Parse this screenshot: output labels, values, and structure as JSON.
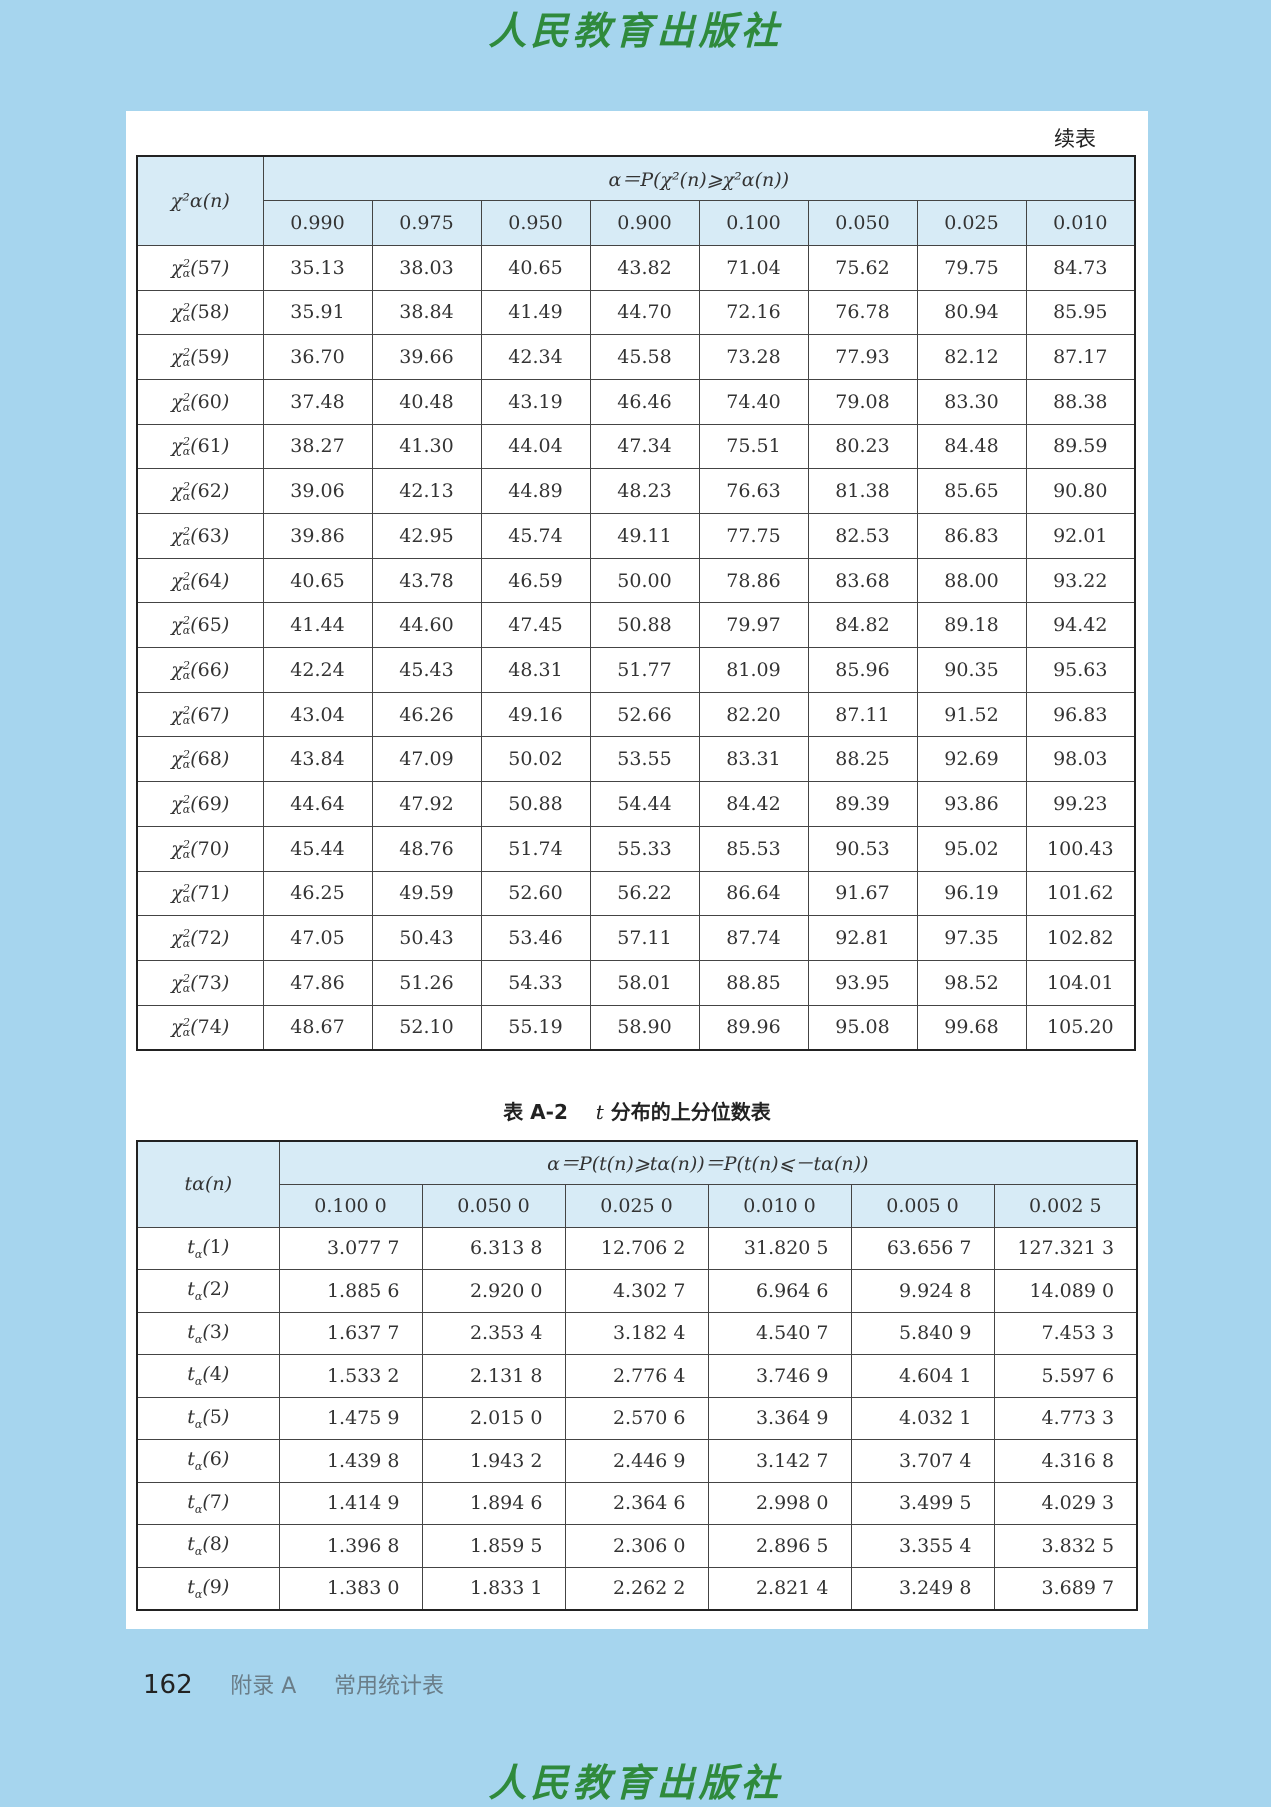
{
  "watermark": "人民教育出版社",
  "continued_label": "续表",
  "chi_table": {
    "row_header": "χ²α(n)",
    "alpha_header": "α＝P(χ²(n)⩾χ²α(n))",
    "alphas": [
      "0.990",
      "0.975",
      "0.950",
      "0.900",
      "0.100",
      "0.050",
      "0.025",
      "0.010"
    ],
    "rows": [
      {
        "n": "57",
        "values": [
          "35.13",
          "38.03",
          "40.65",
          "43.82",
          "71.04",
          "75.62",
          "79.75",
          "84.73"
        ]
      },
      {
        "n": "58",
        "values": [
          "35.91",
          "38.84",
          "41.49",
          "44.70",
          "72.16",
          "76.78",
          "80.94",
          "85.95"
        ]
      },
      {
        "n": "59",
        "values": [
          "36.70",
          "39.66",
          "42.34",
          "45.58",
          "73.28",
          "77.93",
          "82.12",
          "87.17"
        ]
      },
      {
        "n": "60",
        "values": [
          "37.48",
          "40.48",
          "43.19",
          "46.46",
          "74.40",
          "79.08",
          "83.30",
          "88.38"
        ]
      },
      {
        "n": "61",
        "values": [
          "38.27",
          "41.30",
          "44.04",
          "47.34",
          "75.51",
          "80.23",
          "84.48",
          "89.59"
        ]
      },
      {
        "n": "62",
        "values": [
          "39.06",
          "42.13",
          "44.89",
          "48.23",
          "76.63",
          "81.38",
          "85.65",
          "90.80"
        ]
      },
      {
        "n": "63",
        "values": [
          "39.86",
          "42.95",
          "45.74",
          "49.11",
          "77.75",
          "82.53",
          "86.83",
          "92.01"
        ]
      },
      {
        "n": "64",
        "values": [
          "40.65",
          "43.78",
          "46.59",
          "50.00",
          "78.86",
          "83.68",
          "88.00",
          "93.22"
        ]
      },
      {
        "n": "65",
        "values": [
          "41.44",
          "44.60",
          "47.45",
          "50.88",
          "79.97",
          "84.82",
          "89.18",
          "94.42"
        ]
      },
      {
        "n": "66",
        "values": [
          "42.24",
          "45.43",
          "48.31",
          "51.77",
          "81.09",
          "85.96",
          "90.35",
          "95.63"
        ]
      },
      {
        "n": "67",
        "values": [
          "43.04",
          "46.26",
          "49.16",
          "52.66",
          "82.20",
          "87.11",
          "91.52",
          "96.83"
        ]
      },
      {
        "n": "68",
        "values": [
          "43.84",
          "47.09",
          "50.02",
          "53.55",
          "83.31",
          "88.25",
          "92.69",
          "98.03"
        ]
      },
      {
        "n": "69",
        "values": [
          "44.64",
          "47.92",
          "50.88",
          "54.44",
          "84.42",
          "89.39",
          "93.86",
          "99.23"
        ]
      },
      {
        "n": "70",
        "values": [
          "45.44",
          "48.76",
          "51.74",
          "55.33",
          "85.53",
          "90.53",
          "95.02",
          "100.43"
        ]
      },
      {
        "n": "71",
        "values": [
          "46.25",
          "49.59",
          "52.60",
          "56.22",
          "86.64",
          "91.67",
          "96.19",
          "101.62"
        ]
      },
      {
        "n": "72",
        "values": [
          "47.05",
          "50.43",
          "53.46",
          "57.11",
          "87.74",
          "92.81",
          "97.35",
          "102.82"
        ]
      },
      {
        "n": "73",
        "values": [
          "47.86",
          "51.26",
          "54.33",
          "58.01",
          "88.85",
          "93.95",
          "98.52",
          "104.01"
        ]
      },
      {
        "n": "74",
        "values": [
          "48.67",
          "52.10",
          "55.19",
          "58.90",
          "89.96",
          "95.08",
          "99.68",
          "105.20"
        ]
      }
    ]
  },
  "t_table": {
    "caption_prefix": "表 A-2",
    "caption_var": "t",
    "caption_suffix": "分布的上分位数表",
    "row_header": "tα(n)",
    "alpha_header": "α＝P(t(n)⩾tα(n))＝P(t(n)⩽－tα(n))",
    "alphas": [
      "0.100 0",
      "0.050 0",
      "0.025 0",
      "0.010 0",
      "0.005 0",
      "0.002 5"
    ],
    "rows": [
      {
        "n": "1",
        "values": [
          "3.077 7",
          "6.313 8",
          "12.706 2",
          "31.820 5",
          "63.656 7",
          "127.321 3"
        ]
      },
      {
        "n": "2",
        "values": [
          "1.885 6",
          "2.920 0",
          "4.302 7",
          "6.964 6",
          "9.924 8",
          "14.089 0"
        ]
      },
      {
        "n": "3",
        "values": [
          "1.637 7",
          "2.353 4",
          "3.182 4",
          "4.540 7",
          "5.840 9",
          "7.453 3"
        ]
      },
      {
        "n": "4",
        "values": [
          "1.533 2",
          "2.131 8",
          "2.776 4",
          "3.746 9",
          "4.604 1",
          "5.597 6"
        ]
      },
      {
        "n": "5",
        "values": [
          "1.475 9",
          "2.015 0",
          "2.570 6",
          "3.364 9",
          "4.032 1",
          "4.773 3"
        ]
      },
      {
        "n": "6",
        "values": [
          "1.439 8",
          "1.943 2",
          "2.446 9",
          "3.142 7",
          "3.707 4",
          "4.316 8"
        ]
      },
      {
        "n": "7",
        "values": [
          "1.414 9",
          "1.894 6",
          "2.364 6",
          "2.998 0",
          "3.499 5",
          "4.029 3"
        ]
      },
      {
        "n": "8",
        "values": [
          "1.396 8",
          "1.859 5",
          "2.306 0",
          "2.896 5",
          "3.355 4",
          "3.832 5"
        ]
      },
      {
        "n": "9",
        "values": [
          "1.383 0",
          "1.833 1",
          "2.262 2",
          "2.821 4",
          "3.249 8",
          "3.689 7"
        ]
      }
    ]
  },
  "footer": {
    "page_number": "162",
    "section": "附录 A",
    "title": "常用统计表"
  }
}
